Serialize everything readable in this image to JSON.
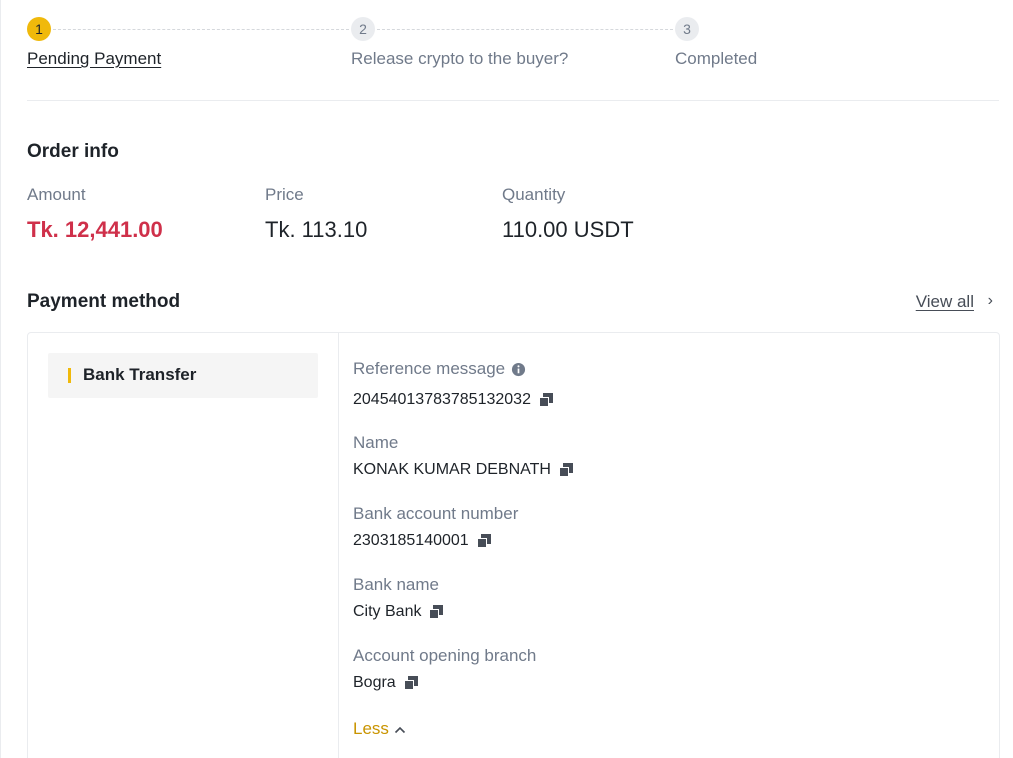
{
  "stepper": {
    "steps": [
      {
        "number": "1",
        "label": "Pending Payment"
      },
      {
        "number": "2",
        "label": "Release crypto to the buyer?"
      },
      {
        "number": "3",
        "label": "Completed"
      }
    ]
  },
  "order_info": {
    "title": "Order info",
    "amount_label": "Amount",
    "amount_value": "Tk. 12,441.00",
    "price_label": "Price",
    "price_value": "Tk. 113.10",
    "quantity_label": "Quantity",
    "quantity_value": "110.00 USDT"
  },
  "payment": {
    "title": "Payment method",
    "view_all": "View all",
    "view_all_chevron": "›",
    "method": "Bank Transfer",
    "fields": [
      {
        "label": "Reference message",
        "value": "20454013783785132032"
      },
      {
        "label": "Name",
        "value": "KONAK KUMAR DEBNATH"
      },
      {
        "label": "Bank account number",
        "value": "2303185140001"
      },
      {
        "label": "Bank name",
        "value": "City Bank"
      },
      {
        "label": "Account opening branch",
        "value": "Bogra"
      }
    ],
    "less_label": "Less",
    "less_chevron": "^"
  },
  "colors": {
    "accent_yellow": "#f0b90b",
    "amount_red": "#cf304a",
    "less_gold": "#c99400"
  },
  "icons": {
    "copy": "copy-icon",
    "info": "info-circle-icon",
    "chevron_right": "chevron-right-icon",
    "chevron_up": "chevron-up-icon"
  }
}
